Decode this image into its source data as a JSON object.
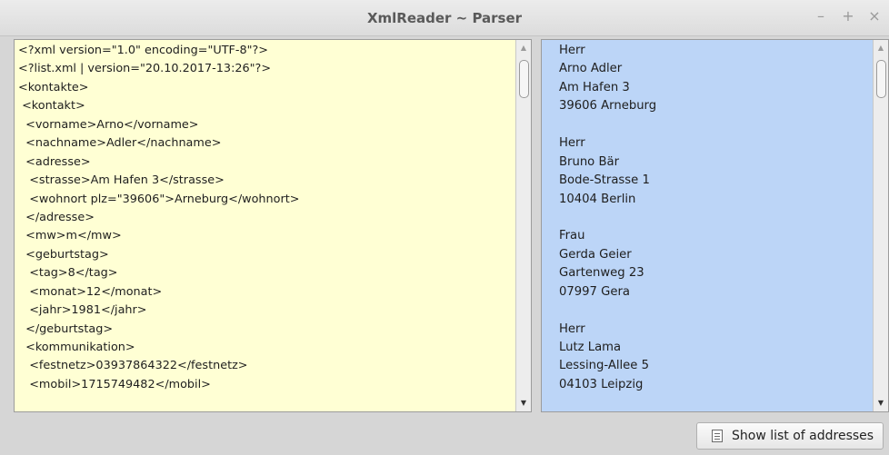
{
  "window": {
    "title": "XmlReader ~ Parser",
    "controls": {
      "minimize": "–",
      "maximize": "+",
      "close": "×"
    }
  },
  "xml_panel": {
    "lines": [
      "<?xml version=\"1.0\" encoding=\"UTF-8\"?>",
      "<?list.xml | version=\"20.10.2017-13:26\"?>",
      "<kontakte>",
      " <kontakt>",
      "  <vorname>Arno</vorname>",
      "  <nachname>Adler</nachname>",
      "  <adresse>",
      "   <strasse>Am Hafen 3</strasse>",
      "   <wohnort plz=\"39606\">Arneburg</wohnort>",
      "  </adresse>",
      "  <mw>m</mw>",
      "  <geburtstag>",
      "   <tag>8</tag>",
      "   <monat>12</monat>",
      "   <jahr>1981</jahr>",
      "  </geburtstag>",
      "  <kommunikation>",
      "   <festnetz>03937864322</festnetz>",
      "   <mobil>1715749482</mobil>"
    ]
  },
  "address_panel": {
    "lines": [
      "Herr",
      "Arno Adler",
      "Am Hafen 3",
      "39606 Arneburg",
      "",
      "Herr",
      "Bruno Bär",
      "Bode-Strasse 1",
      "10404 Berlin",
      "",
      "Frau",
      "Gerda Geier",
      "Gartenweg 23",
      "07997 Gera",
      "",
      "Herr",
      "Lutz Lama",
      "Lessing-Allee 5",
      "04103 Leipzig"
    ]
  },
  "scroll_arrows": {
    "up": "▲",
    "down": "▼"
  },
  "actions": {
    "show_list_label": "Show list of addresses",
    "show_list_icon": "list-document-icon"
  }
}
